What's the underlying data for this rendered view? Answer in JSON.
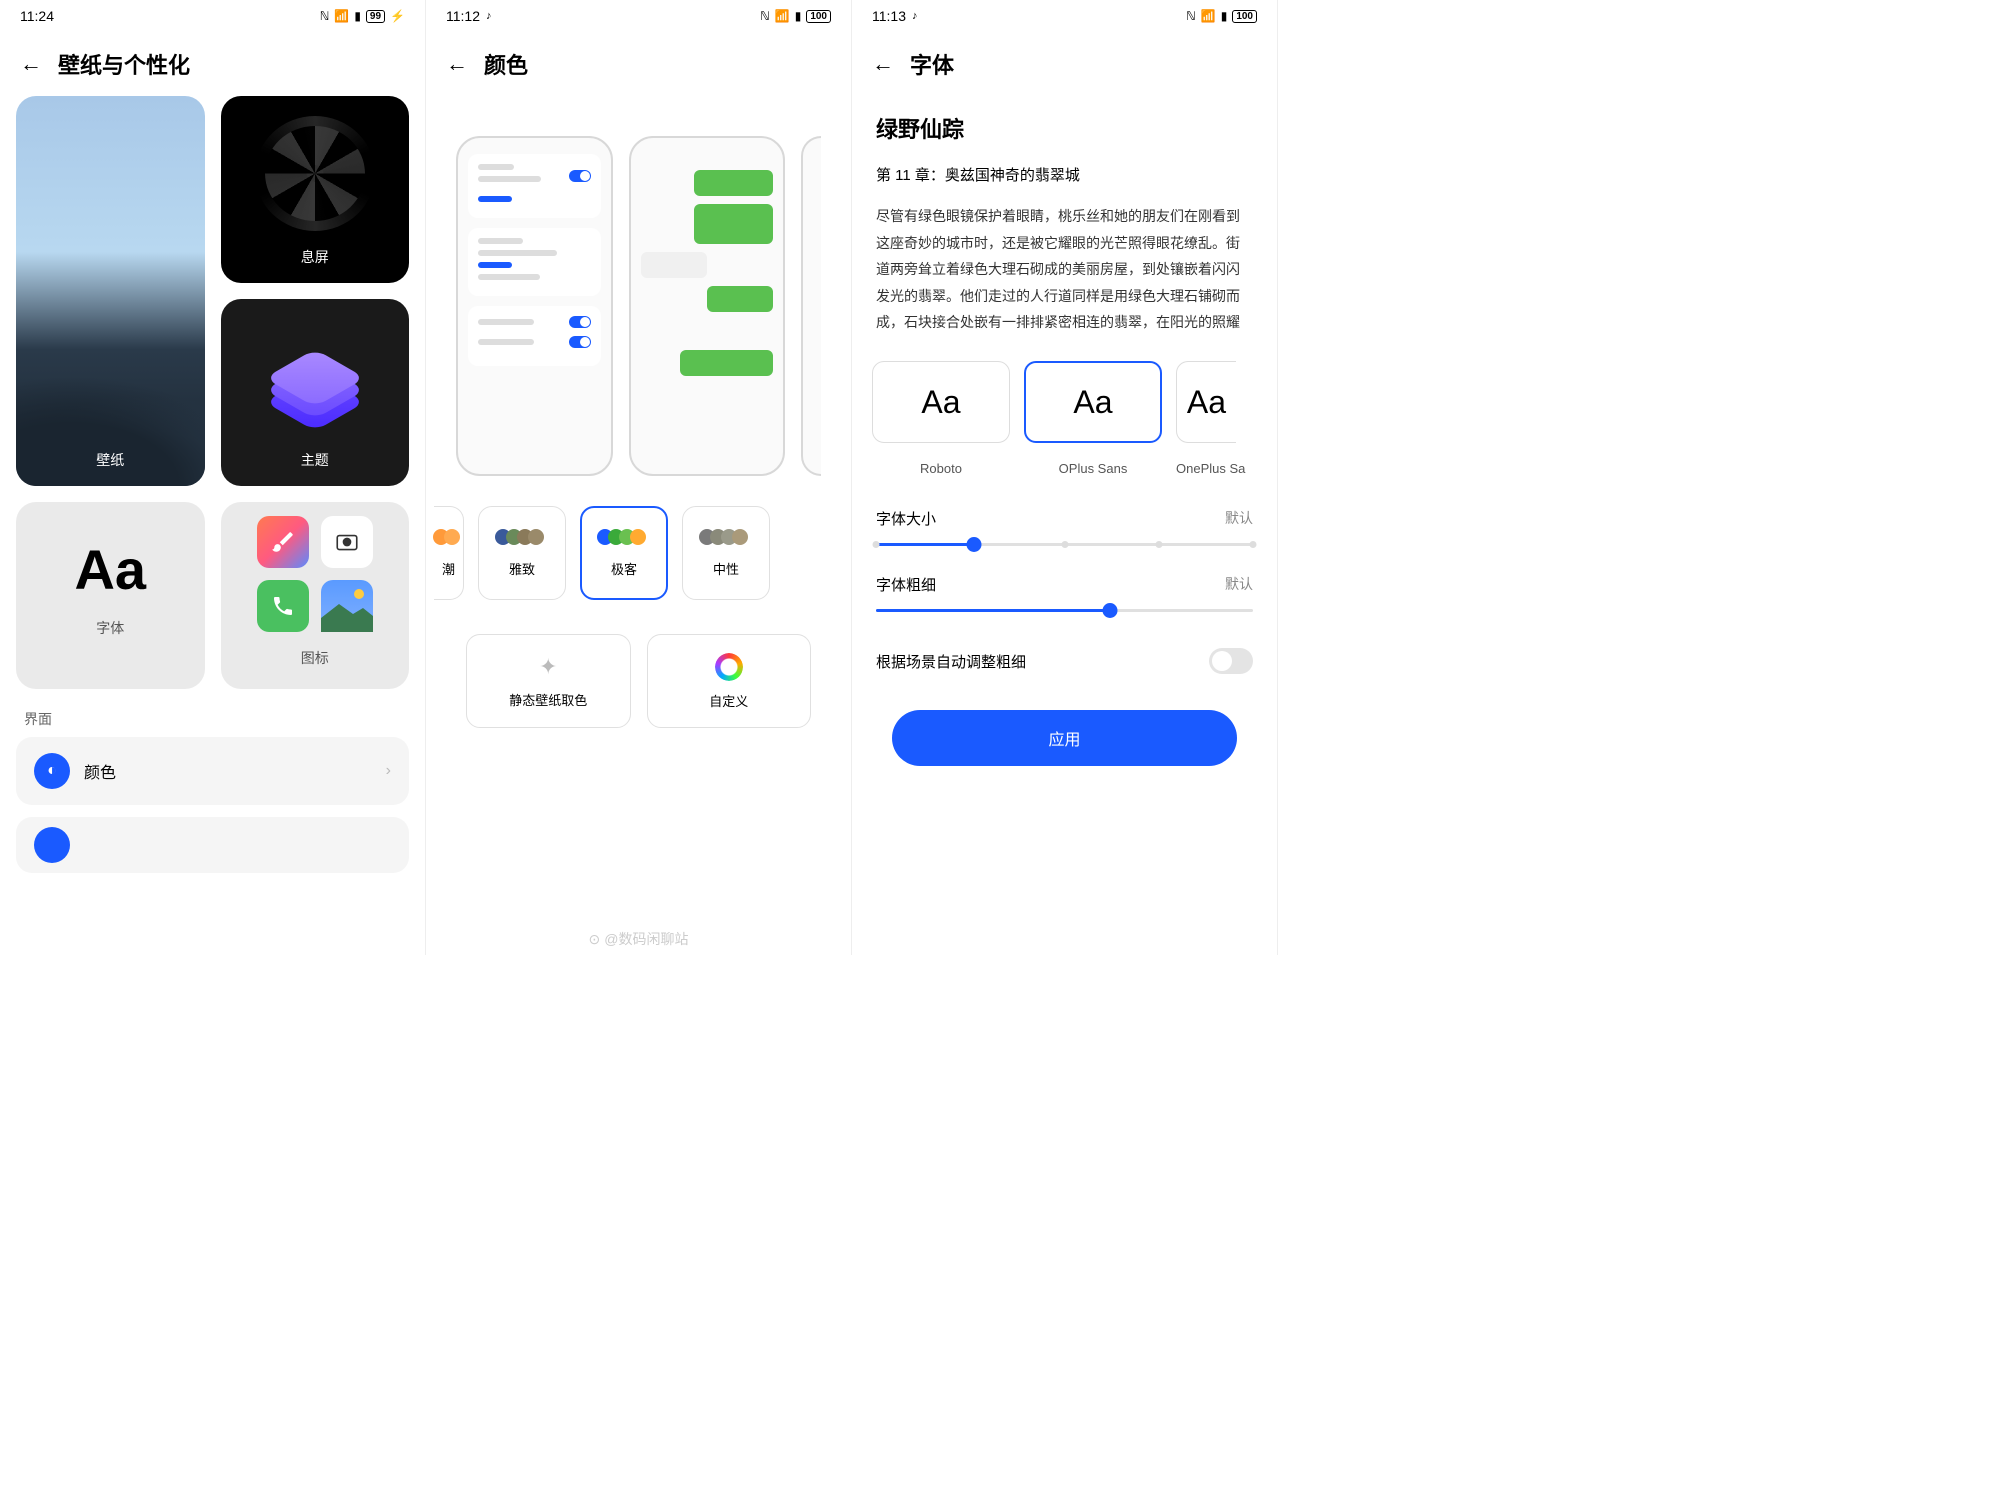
{
  "screen1": {
    "time": "11:24",
    "battery": "99",
    "title": "壁纸与个性化",
    "tile_wallpaper": "壁纸",
    "tile_aod": "息屏",
    "tile_theme": "主题",
    "tile_font": "字体",
    "tile_font_sample": "Aa",
    "tile_icons": "图标",
    "section": "界面",
    "list_color": "颜色"
  },
  "screen2": {
    "time": "11:12",
    "battery": "100",
    "title": "颜色",
    "palettes": [
      "潮",
      "雅致",
      "极客",
      "中性"
    ],
    "action_wallpaper": "静态壁纸取色",
    "action_custom": "自定义",
    "watermark": "@数码闲聊站"
  },
  "screen3": {
    "time": "11:13",
    "battery": "100",
    "title": "字体",
    "sample_title": "绿野仙踪",
    "sample_sub": "第 11 章：奥兹国神奇的翡翠城",
    "sample_body": "尽管有绿色眼镜保护着眼睛，桃乐丝和她的朋友们在刚看到这座奇妙的城市时，还是被它耀眼的光芒照得眼花缭乱。街道两旁耸立着绿色大理石砌成的美丽房屋，到处镶嵌着闪闪发光的翡翠。他们走过的人行道同样是用绿色大理石铺砌而成，石块接合处嵌有一排排紧密相连的翡翠，在阳光的照耀",
    "fonts": [
      "Roboto",
      "OPlus Sans",
      "OnePlus Sa"
    ],
    "font_sample": "Aa",
    "size_label": "字体大小",
    "size_value": "默认",
    "weight_label": "字体粗细",
    "weight_value": "默认",
    "auto_weight": "根据场景自动调整粗细",
    "apply": "应用"
  }
}
